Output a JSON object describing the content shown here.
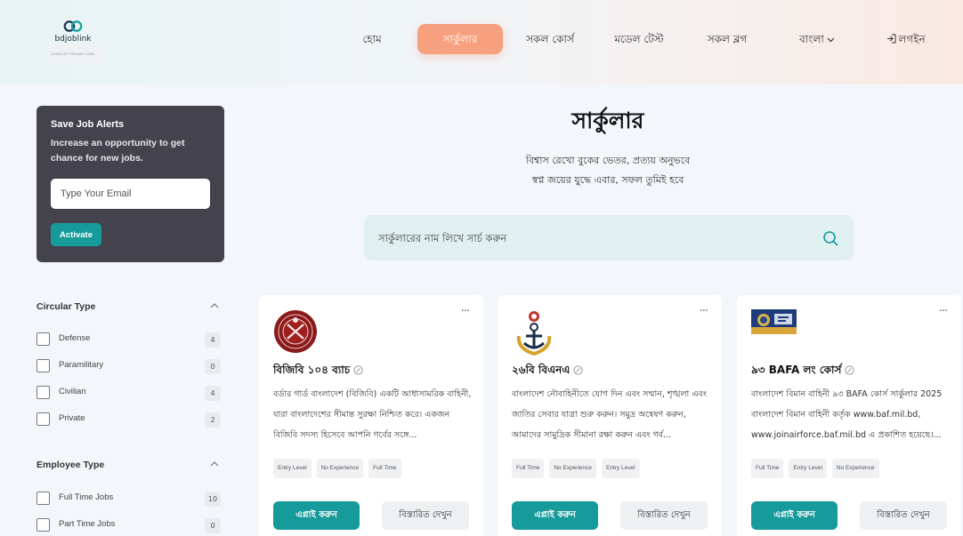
{
  "brand": {
    "name": "bdjoblink",
    "tagline": "LEARN MY PRIMARY JOBS"
  },
  "nav": {
    "items": [
      {
        "label": "হোম"
      },
      {
        "label": "সার্কুলার",
        "active": true
      },
      {
        "label": "সকল কোর্স"
      },
      {
        "label": "মডেল টেস্ট"
      },
      {
        "label": "সকল ব্লগ"
      },
      {
        "label": "বাংলা"
      },
      {
        "label": "লগইন"
      }
    ]
  },
  "alerts": {
    "title": "Save Job Alerts",
    "description": "Increase an opportunity to get chance for new jobs.",
    "email_placeholder": "Type Your Email",
    "button_label": "Activate"
  },
  "filters": {
    "circular_type": {
      "title": "Circular Type",
      "options": [
        {
          "label": "Defense",
          "count": "4"
        },
        {
          "label": "Paramilitary",
          "count": "0"
        },
        {
          "label": "Civilian",
          "count": "4"
        },
        {
          "label": "Private",
          "count": "2"
        }
      ]
    },
    "employee_type": {
      "title": "Employee Type",
      "options": [
        {
          "label": "Full Time Jobs",
          "count": "10"
        },
        {
          "label": "Part Time Jobs",
          "count": "0"
        }
      ]
    }
  },
  "hero": {
    "title": "সার্কুলার",
    "subtitle_line1": "বিশ্বাস রেখো বুকের ভেতর, প্রত্যয় অনুভবে",
    "subtitle_line2": "স্বপ্ন জয়ের যুদ্ধে এবার, সফল তুমিই হবে"
  },
  "search": {
    "placeholder": "সার্কুলারের নাম লিখে সার্চ করুন"
  },
  "cards": [
    {
      "title": "বিজিবি ১০৪ ব্যাচ",
      "description": "বর্ডার গার্ড বাংলাদেশ (বিজিবি) একটি আধাসামরিক বাহিনী, যারা বাংলাদেশের সীমান্ত সুরক্ষা নিশ্চিত করে। একজন বিজিবি সদস্য হিসেবে আপনি গর্বের সঙ্গে...",
      "tags": [
        "Entry Level",
        "No Experience",
        "Full Time"
      ],
      "apply_label": "এপ্লাই করুন",
      "detail_label": "বিস্তারিত দেখুন"
    },
    {
      "title": "২৬বি বিএনএ",
      "description": "বাংলাদেশ নৌবাহিনীতে যোগ দিন এবং সম্মান, শৃঙ্খলা এবং জাতির সেবার যাত্রা শুরু করুন। সমুদ্র অন্বেষণ করুন, আমাদের সামুদ্রিক সীমানা রক্ষা করুন এবং গর্ব...",
      "tags": [
        "Full Time",
        "No Experience",
        "Entry Level"
      ],
      "apply_label": "এপ্লাই করুন",
      "detail_label": "বিস্তারিত দেখুন"
    },
    {
      "title": "৯৩ BAFA লং কোর্স",
      "description": "বাংলাদেশ বিমান বাহিনী ৯৩ BAFA কোর্স সার্কুলার 2025 বাংলাদেশ বিমান বাহিনী কর্তৃক www.baf.mil.bd, www.joinairforce.baf.mil.bd এ প্রকাশিত হয়েছে।...",
      "tags": [
        "Full Time",
        "Entry Level",
        "No Experience"
      ],
      "apply_label": "এপ্লাই করুন",
      "detail_label": "বিস্তারিত দেখুন"
    }
  ]
}
